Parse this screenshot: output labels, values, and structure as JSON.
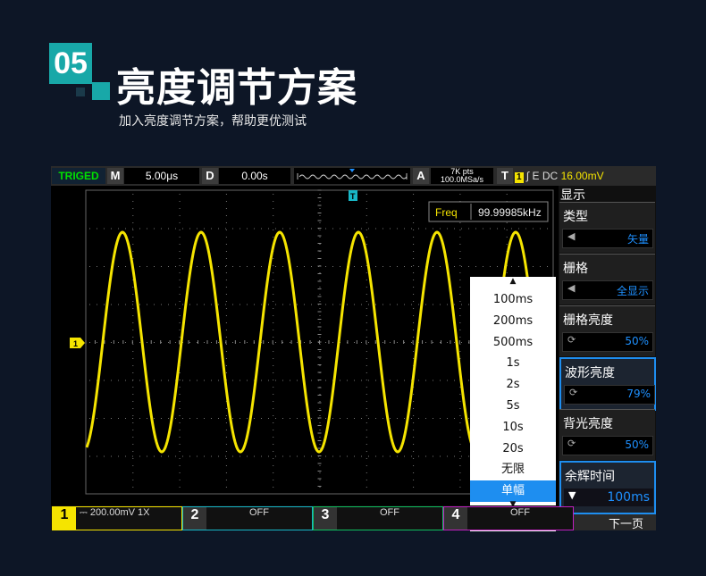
{
  "header": {
    "badge": "05",
    "title": "亮度调节方案",
    "subtitle": "加入亮度调节方案，帮助更优测试"
  },
  "topbar": {
    "trig_status": "TRIGED",
    "m_label": "M",
    "timebase": "5.00μs",
    "d_label": "D",
    "delay": "0.00s",
    "a_label": "A",
    "points": "7K pts",
    "sample_rate": "100.0MSa/s",
    "t_label": "T",
    "trig_channel": "1",
    "trig_mode": "E DC",
    "trig_level": "16.00mV"
  },
  "measure": {
    "label": "Freq",
    "value": "99.99985kHz"
  },
  "markers": {
    "trigger_pos": "T",
    "ch1_level": "1"
  },
  "menu": {
    "title": "显示",
    "items": [
      {
        "label": "类型",
        "value": "矢量",
        "icon": "left-arrow"
      },
      {
        "label": "栅格",
        "value": "全显示",
        "icon": "left-arrow"
      },
      {
        "label": "栅格亮度",
        "value": "50%",
        "icon": "rotate-icon"
      },
      {
        "label": "波形亮度",
        "value": "79%",
        "icon": "rotate-icon"
      },
      {
        "label": "背光亮度",
        "value": "50%",
        "icon": "rotate-icon"
      },
      {
        "label": "余辉时间",
        "value": "100ms",
        "icon": "down-arrow"
      }
    ],
    "next_page": "下一页"
  },
  "dropdown": {
    "options": [
      "100ms",
      "200ms",
      "500ms",
      "1s",
      "2s",
      "5s",
      "10s",
      "20s",
      "无限",
      "单幅"
    ],
    "selected": "单幅"
  },
  "channels": [
    {
      "num": "1",
      "text": "200.00mV",
      "probe": "1X",
      "color": "#f5e400"
    },
    {
      "num": "2",
      "text": "OFF",
      "color": "#18b8c8"
    },
    {
      "num": "3",
      "text": "OFF",
      "color": "#10c060"
    },
    {
      "num": "4",
      "text": "OFF",
      "color": "#c020c0"
    }
  ],
  "colors": {
    "accent": "#18a8a8",
    "waveform": "#f5e400",
    "menu_highlight": "#1e8ef0"
  }
}
